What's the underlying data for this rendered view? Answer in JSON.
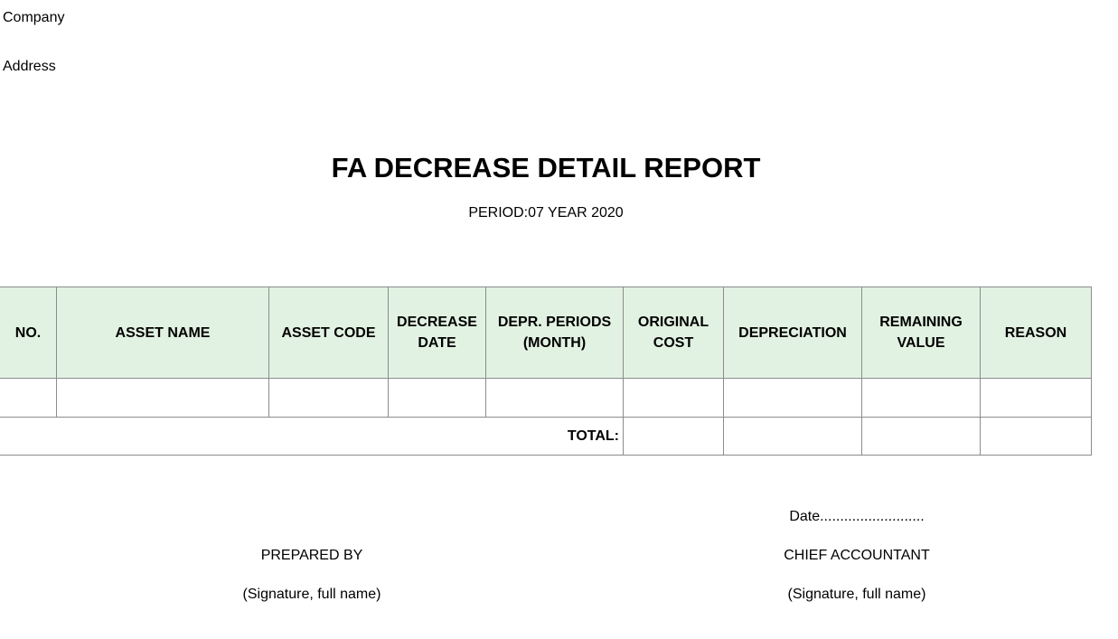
{
  "header": {
    "company": "Company",
    "address": "Address",
    "title": "FA DECREASE DETAIL REPORT",
    "period": "PERIOD:07 YEAR 2020"
  },
  "table": {
    "columns": [
      {
        "line1": "NO.",
        "line2": ""
      },
      {
        "line1": "ASSET NAME",
        "line2": ""
      },
      {
        "line1": "ASSET CODE",
        "line2": ""
      },
      {
        "line1": "DECREASE",
        "line2": "DATE"
      },
      {
        "line1": "DEPR. PERIODS",
        "line2": "(MONTH)"
      },
      {
        "line1": "ORIGINAL",
        "line2": "COST"
      },
      {
        "line1": "DEPRECIATION",
        "line2": ""
      },
      {
        "line1": "REMAINING",
        "line2": "VALUE"
      },
      {
        "line1": "REASON",
        "line2": ""
      }
    ],
    "total_label": "TOTAL:"
  },
  "footer": {
    "date": "Date..........................",
    "prepared_by": "PREPARED BY",
    "prepared_by_sub": "(Signature, full name)",
    "chief_accountant": "CHIEF ACCOUNTANT",
    "chief_accountant_sub": "(Signature, full name)"
  }
}
